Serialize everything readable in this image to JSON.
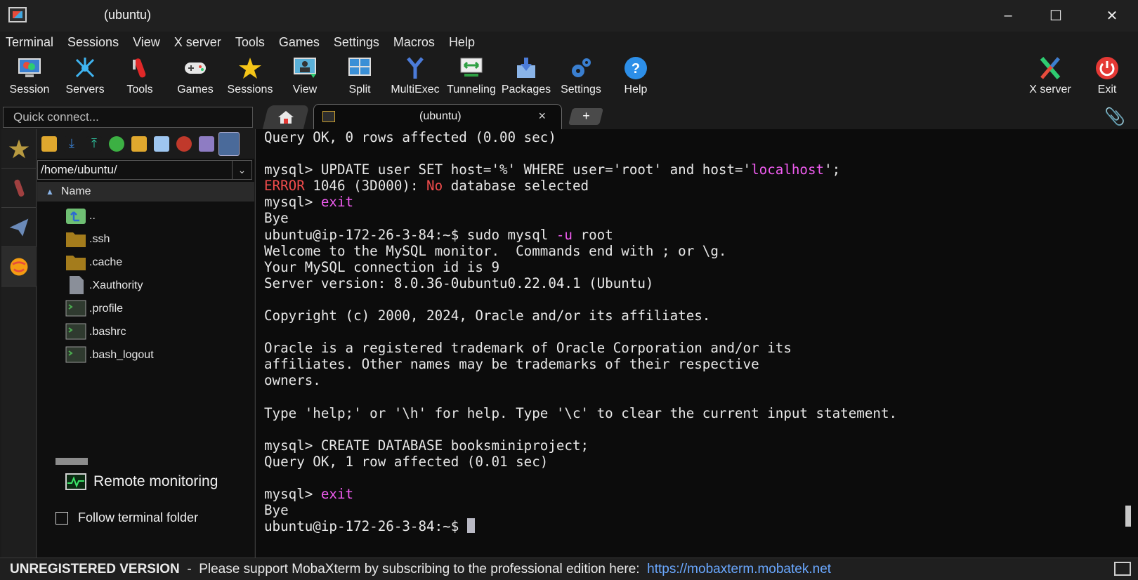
{
  "window": {
    "title": "(ubuntu)",
    "minimize": "–",
    "maximize": "☐",
    "close": "✕"
  },
  "menu": [
    "Terminal",
    "Sessions",
    "View",
    "X server",
    "Tools",
    "Games",
    "Settings",
    "Macros",
    "Help"
  ],
  "toolbar": {
    "session": "Session",
    "servers": "Servers",
    "tools": "Tools",
    "games": "Games",
    "sessions": "Sessions",
    "view": "View",
    "split": "Split",
    "multiexec": "MultiExec",
    "tunneling": "Tunneling",
    "packages": "Packages",
    "settings": "Settings",
    "help": "Help",
    "xserver": "X server",
    "exit": "Exit"
  },
  "quick_connect": {
    "placeholder": "Quick connect..."
  },
  "tabs": {
    "session_label": "(ubuntu)",
    "close": "×",
    "new": "+"
  },
  "sftp": {
    "path": "/home/ubuntu/",
    "column_name": "Name",
    "files": [
      {
        "name": "..",
        "icon": "parent-folder-icon"
      },
      {
        "name": ".ssh",
        "icon": "folder-icon"
      },
      {
        "name": ".cache",
        "icon": "folder-icon"
      },
      {
        "name": ".Xauthority",
        "icon": "file-icon"
      },
      {
        "name": ".profile",
        "icon": "script-icon"
      },
      {
        "name": ".bashrc",
        "icon": "script-icon"
      },
      {
        "name": ".bash_logout",
        "icon": "script-icon"
      }
    ],
    "remote_monitoring": "Remote monitoring",
    "follow_terminal_folder": "Follow terminal folder"
  },
  "terminal": {
    "lines": [
      [
        {
          "t": "Query OK, 0 rows affected (0.00 sec)"
        }
      ],
      [
        {
          "t": ""
        }
      ],
      [
        {
          "t": "mysql> UPDATE user SET host='%' WHERE user='root' and host='"
        },
        {
          "t": "localhost",
          "c": "mag"
        },
        {
          "t": "';"
        }
      ],
      [
        {
          "t": "ERROR",
          "c": "red"
        },
        {
          "t": " 1046 (3D000): "
        },
        {
          "t": "No",
          "c": "red"
        },
        {
          "t": " database selected"
        }
      ],
      [
        {
          "t": "mysql> "
        },
        {
          "t": "exit",
          "c": "mag"
        }
      ],
      [
        {
          "t": "Bye"
        }
      ],
      [
        {
          "t": "ubuntu@ip-172-26-3-84:~$ sudo mysql "
        },
        {
          "t": "-u",
          "c": "mag"
        },
        {
          "t": " root"
        }
      ],
      [
        {
          "t": "Welcome to the MySQL monitor.  Commands end with ; or \\g."
        }
      ],
      [
        {
          "t": "Your MySQL connection id is 9"
        }
      ],
      [
        {
          "t": "Server version: 8.0.36-0ubuntu0.22.04.1 (Ubuntu)"
        }
      ],
      [
        {
          "t": ""
        }
      ],
      [
        {
          "t": "Copyright (c) 2000, 2024, Oracle and/or its affiliates."
        }
      ],
      [
        {
          "t": ""
        }
      ],
      [
        {
          "t": "Oracle is a registered trademark of Oracle Corporation and/or its"
        }
      ],
      [
        {
          "t": "affiliates. Other names may be trademarks of their respective"
        }
      ],
      [
        {
          "t": "owners."
        }
      ],
      [
        {
          "t": ""
        }
      ],
      [
        {
          "t": "Type 'help;' or '\\h' for help. Type '\\c' to clear the current input statement."
        }
      ],
      [
        {
          "t": ""
        }
      ],
      [
        {
          "t": "mysql> CREATE DATABASE booksminiproject;"
        }
      ],
      [
        {
          "t": "Query OK, 1 row affected (0.01 sec)"
        }
      ],
      [
        {
          "t": ""
        }
      ],
      [
        {
          "t": "mysql> "
        },
        {
          "t": "exit",
          "c": "mag"
        }
      ],
      [
        {
          "t": "Bye"
        }
      ],
      [
        {
          "t": "ubuntu@ip-172-26-3-84:~$ "
        },
        {
          "cursor": true
        }
      ]
    ]
  },
  "status": {
    "unregistered": "UNREGISTERED VERSION",
    "separator": "  -  ",
    "message": "Please support MobaXterm by subscribing to the professional edition here:  ",
    "link": "https://mobaxterm.mobatek.net"
  },
  "colors": {
    "terminal_bg": "#0c0c0c",
    "accent_red": "#f14c4c",
    "accent_magenta": "#f05cf0",
    "link": "#6aa8ff"
  }
}
